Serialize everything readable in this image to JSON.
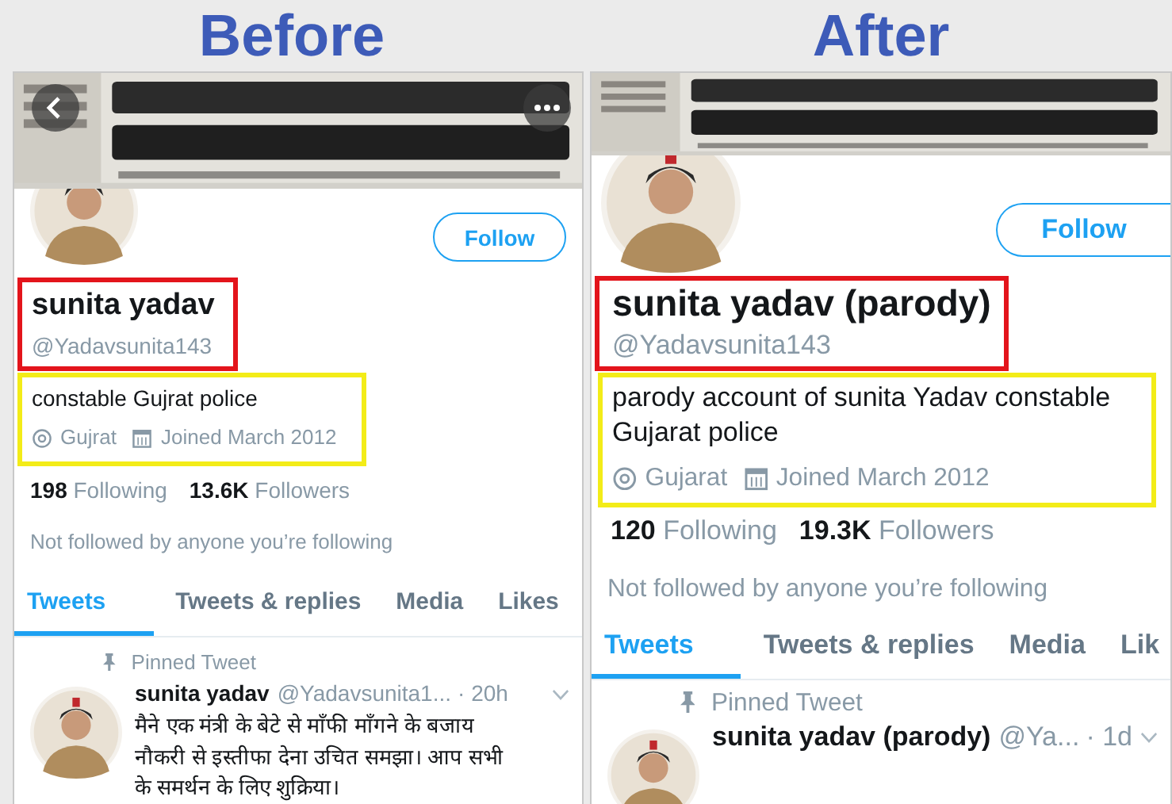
{
  "panels": [
    {
      "label": "Before",
      "nav_buttons": true,
      "follow_button": "Follow",
      "name": "sunita yadav",
      "handle": "@Yadavsunita143",
      "bio": "constable Gujrat police",
      "location": "Gujrat",
      "joined": "Joined March 2012",
      "stats": [
        {
          "count": "198",
          "label": "Following"
        },
        {
          "count": "13.6K",
          "label": "Followers"
        }
      ],
      "followed_by": "Not followed by anyone you’re following",
      "tabs": [
        {
          "label": "Tweets",
          "selected": true
        },
        {
          "label": "Tweets & replies",
          "selected": false
        },
        {
          "label": "Media",
          "selected": false
        },
        {
          "label": "Likes",
          "selected": false
        }
      ],
      "pinned_label": "Pinned Tweet",
      "tweet": {
        "name": "sunita yadav",
        "handle": "@Yadavsunita1...",
        "time": "· 20h",
        "text": "मैने एक मंत्री के बेटे से माँफी माँगने के बजाय\nनौकरी से इस्तीफा देना उचित समझा।  आप सभी\nके समर्थन के लिए शुक्रिया।"
      }
    },
    {
      "label": "After",
      "nav_buttons": false,
      "follow_button": "Follow",
      "name": "sunita yadav (parody)",
      "handle": "@Yadavsunita143",
      "bio": "parody account of sunita Yadav constable Gujarat police",
      "location": "Gujarat",
      "joined": "Joined March 2012",
      "stats": [
        {
          "count": "120",
          "label": "Following"
        },
        {
          "count": "19.3K",
          "label": "Followers"
        }
      ],
      "followed_by": "Not followed by anyone you’re following",
      "tabs": [
        {
          "label": "Tweets",
          "selected": true
        },
        {
          "label": "Tweets & replies",
          "selected": false
        },
        {
          "label": "Media",
          "selected": false
        },
        {
          "label": "Lik",
          "selected": false
        }
      ],
      "pinned_label": "Pinned Tweet",
      "tweet": {
        "name": "sunita yadav (parody)",
        "handle": "@Ya...",
        "time": "· 1d"
      }
    }
  ]
}
